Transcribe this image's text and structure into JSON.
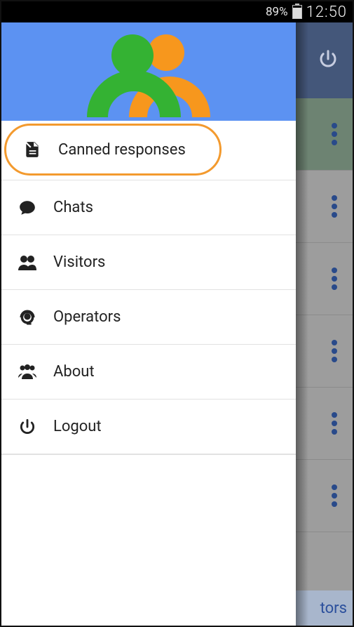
{
  "statusbar": {
    "battery_pct": "89%",
    "time": "12:50"
  },
  "drawer": {
    "items": [
      {
        "label": "Canned responses",
        "icon": "document",
        "highlight": true
      },
      {
        "label": "Chats",
        "icon": "chat"
      },
      {
        "label": "Visitors",
        "icon": "people"
      },
      {
        "label": "Operators",
        "icon": "headset"
      },
      {
        "label": "About",
        "icon": "group"
      },
      {
        "label": "Logout",
        "icon": "power"
      }
    ]
  },
  "background": {
    "bottom_tab_fragment": "tors"
  }
}
